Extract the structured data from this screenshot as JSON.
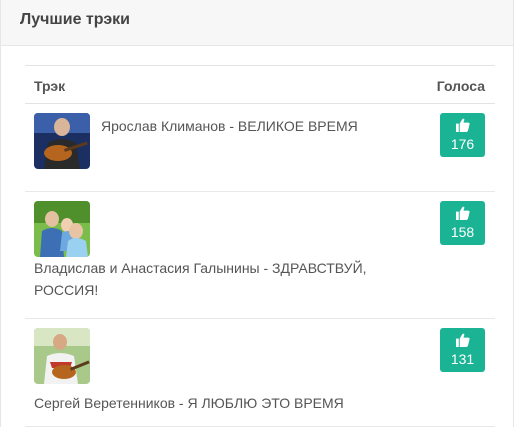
{
  "panel": {
    "title": "Лучшие трэки"
  },
  "table": {
    "header_track": "Трэк",
    "header_votes": "Голоса",
    "rows": [
      {
        "title": "Ярослав Климанов - ВЕЛИКОЕ ВРЕМЯ",
        "votes": "176",
        "thumb_icon": "guitarist-photo"
      },
      {
        "title": "Владислав и Анастасия Галынины - ЗДРАВСТВУЙ, РОССИЯ!",
        "votes": "158",
        "thumb_icon": "family-photo"
      },
      {
        "title": "Сергей Веретенников - Я ЛЮБЛЮ ЭТО ВРЕМЯ",
        "votes": "131",
        "thumb_icon": "guitarist-outdoor-photo"
      }
    ]
  },
  "colors": {
    "vote_button": "#1ab394",
    "header_bg": "#f7f7f7"
  },
  "icons": {
    "vote": "thumbs-up-icon"
  }
}
